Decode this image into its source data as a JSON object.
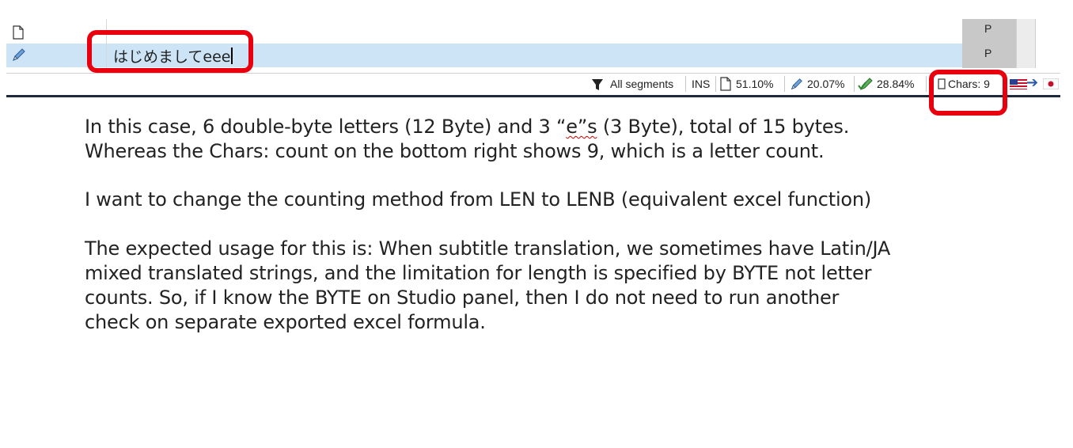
{
  "editor": {
    "segments": [
      {
        "icon": "document-icon",
        "text": "",
        "status_mark": "P"
      },
      {
        "icon": "pencil-icon",
        "text": "はじめましてeee",
        "status_mark": "P"
      }
    ]
  },
  "statusbar": {
    "filter_label": "All segments",
    "mode": "INS",
    "pct_document": "51.10%",
    "pct_pencil": "20.07%",
    "pct_confirmed": "28.84%",
    "chars": "Chars: 9"
  },
  "colors": {
    "highlight_red": "#e8000f",
    "selected_row": "#cde4f7",
    "status_column": "#c8c8c8"
  },
  "body": {
    "p1_l1_pre": "In this case, 6 double-byte letters (12 Byte) and 3 “",
    "p1_l1_sq": "e”s",
    "p1_l1_post": " (3 Byte), total of 15 bytes.",
    "p1_l2": "Whereas the Chars: count on the bottom right shows 9, which is a letter count.",
    "p2_l1": "I want to change the counting method from LEN to LENB (equivalent excel function)",
    "p3_l1": "The expected usage for this is: When subtitle translation, we sometimes have Latin/JA",
    "p3_l2": "mixed translated strings, and the limitation for length is specified by BYTE not letter",
    "p3_l3": "counts. So, if I know the BYTE on Studio panel, then I do not need to run another",
    "p3_l4": "check on separate exported excel formula."
  }
}
